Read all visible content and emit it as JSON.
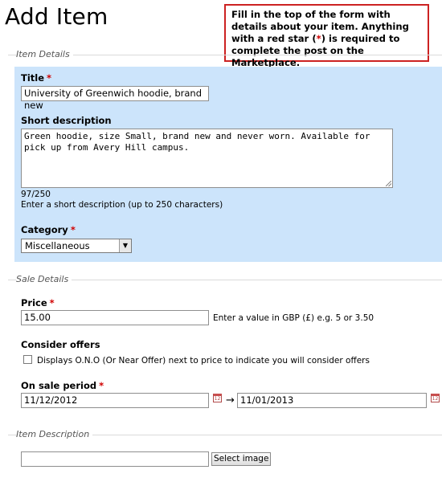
{
  "page": {
    "title": "Add Item",
    "help_text_pre": "Fill in the top of the form with details about your item. Anything with a red star (",
    "help_star": "*",
    "help_text_post": ") is required to complete the post on the Marketplace."
  },
  "required_marker": "*",
  "sections": {
    "item_details": "Item Details",
    "sale_details": "Sale Details",
    "item_description": "Item Description"
  },
  "item_details": {
    "title_label": "Title",
    "title_value": "University of Greenwich hoodie, brand new",
    "short_desc_label": "Short description",
    "short_desc_value": "Green hoodie, size Small, brand new and never worn. Available for pick up from Avery Hill campus.",
    "char_count": "97/250",
    "short_desc_hint": "Enter a short description (up to 250 characters)",
    "category_label": "Category",
    "category_value": "Miscellaneous"
  },
  "sale_details": {
    "price_label": "Price",
    "price_value": "15.00",
    "price_hint": "Enter a value in GBP (£) e.g. 5 or 3.50",
    "offers_label": "Consider offers",
    "offers_checkbox_label": "Displays O.N.O (Or Near Offer) next to price to indicate you will consider offers",
    "sale_period_label": "On sale period",
    "start_date": "11/12/2012",
    "end_date": "11/01/2013",
    "date_separator": "→"
  },
  "item_description": {
    "file_value": "",
    "select_image_label": "Select image"
  },
  "icons": {
    "calendar": "calendar-icon",
    "dropdown": "chevron-down-icon"
  },
  "colors": {
    "panel_bg": "#cce4fb",
    "required": "#d00000",
    "help_border": "#cc2222"
  }
}
